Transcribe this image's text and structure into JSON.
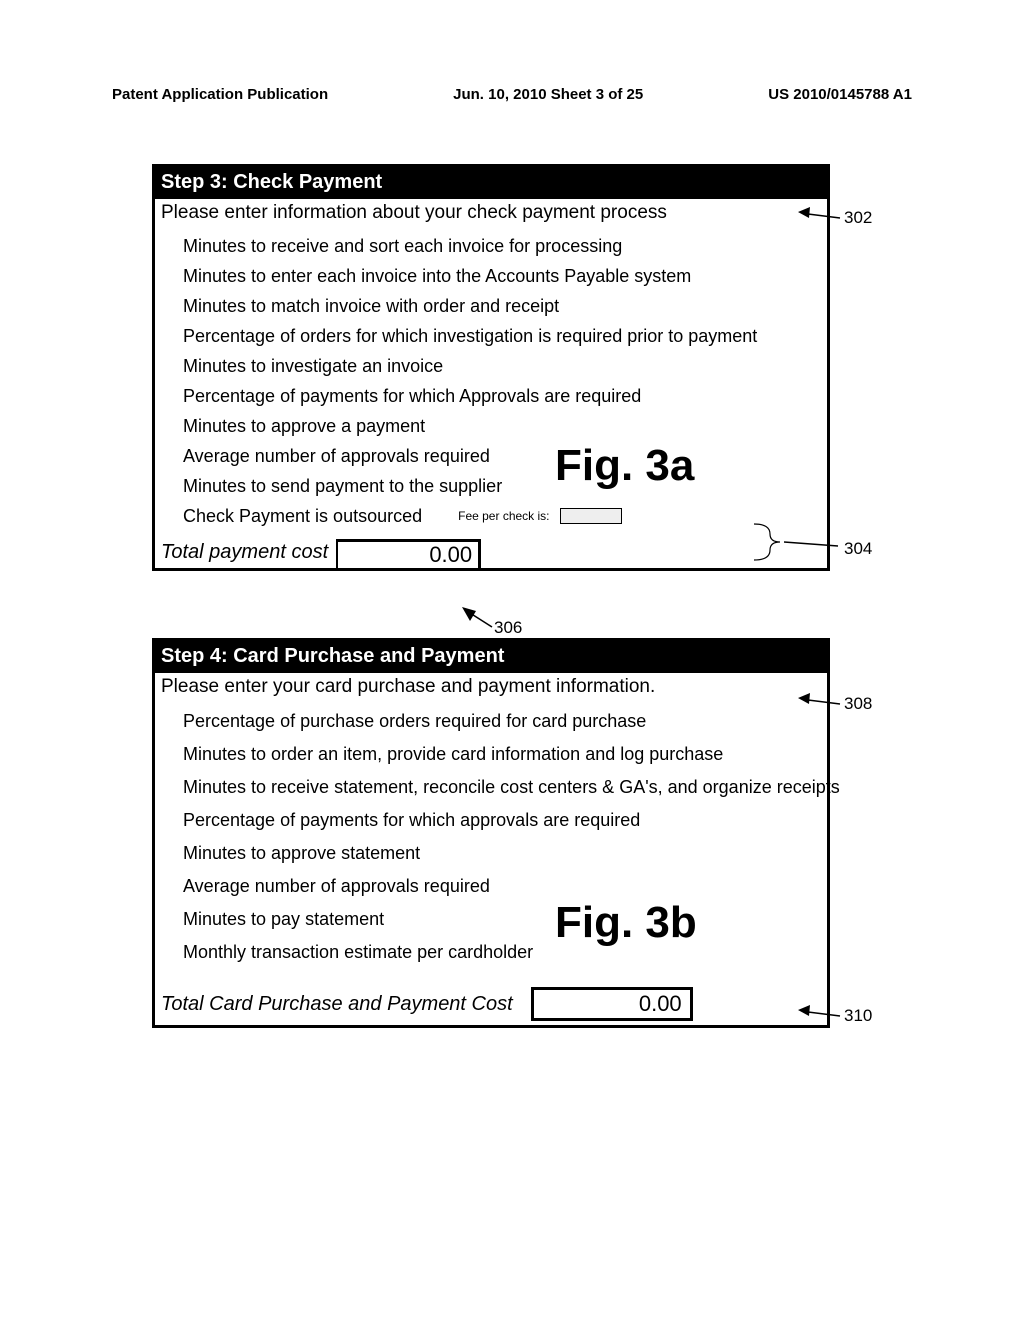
{
  "header": {
    "left": "Patent Application Publication",
    "center": "Jun. 10, 2010  Sheet 3 of 25",
    "right": "US 2010/0145788 A1"
  },
  "panel1": {
    "title": "Step 3: Check Payment",
    "lead": "Please enter information about your check payment process",
    "items": [
      "Minutes to receive and sort each invoice for processing",
      "Minutes to enter each invoice into the Accounts Payable system",
      "Minutes to match invoice with order and receipt",
      "Percentage of orders for which investigation is required prior to payment",
      "Minutes to investigate an invoice",
      "Percentage of payments for which Approvals are required",
      "Minutes to approve a payment",
      "Average number of approvals required",
      "Minutes to send payment to the supplier"
    ],
    "outsourced_label": "Check Payment is outsourced",
    "fee_label": "Fee per check is:",
    "total_label": "Total payment cost",
    "total_value": "0.00"
  },
  "panel2": {
    "title": "Step 4: Card Purchase and Payment",
    "lead": "Please enter your card purchase and payment information.",
    "items": [
      "Percentage of purchase orders required for card purchase",
      "Minutes to order an item, provide card information and log purchase",
      "Minutes to receive statement, reconcile cost centers & GA's, and organize receipts",
      "Percentage of payments for which approvals are required",
      "Minutes to approve statement",
      "Average number of approvals required",
      "Minutes to pay statement",
      "Monthly transaction estimate per cardholder"
    ],
    "total_label": "Total Card Purchase and Payment Cost",
    "total_value": "0.00"
  },
  "figs": {
    "a": "Fig. 3a",
    "b": "Fig. 3b"
  },
  "callouts": {
    "c302": "302",
    "c304": "304",
    "c306": "306",
    "c308": "308",
    "c310": "310"
  }
}
